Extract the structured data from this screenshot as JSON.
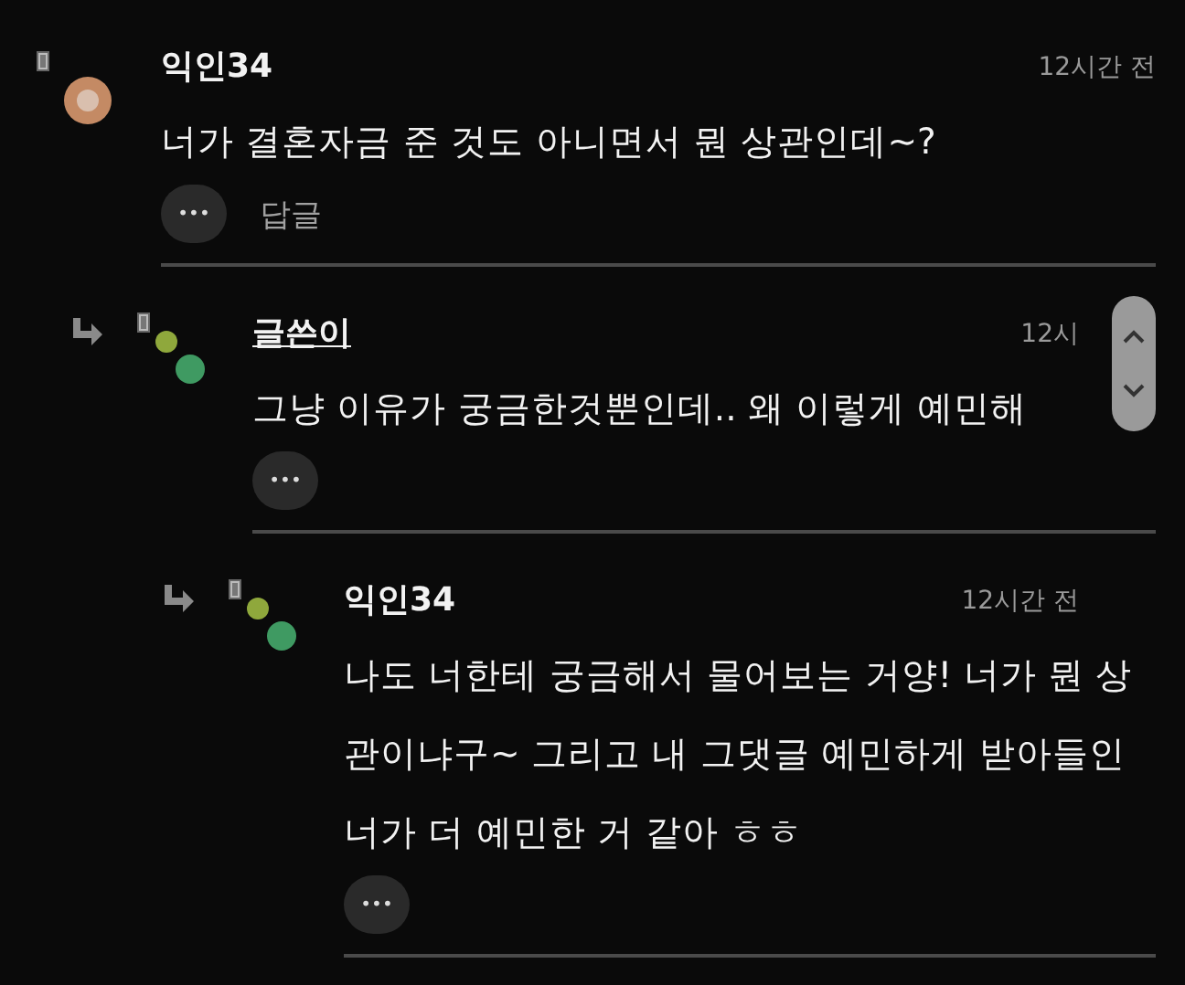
{
  "comments": [
    {
      "author": "익인34",
      "is_writer": false,
      "kind": "circle",
      "time": "12시간 전",
      "body": "너가 결혼자금 준 것도 아니면서 뭔 상관인데~?",
      "more": "•••",
      "reply": "답글",
      "children": [
        {
          "author": "글쓴이",
          "is_writer": true,
          "kind": "dots",
          "time": "12시",
          "body": "그냥 이유가 궁금한것뿐인데.. 왜 이렇게 예민해",
          "more": "•••",
          "children": [
            {
              "author": "익인34",
              "is_writer": false,
              "kind": "dots",
              "time": "12시간 전",
              "body": "나도 너한테 궁금해서 물어보는 거양! 너가 뭔 상관이냐구~ 그리고 내 그댓글 예민하게 받아들인 너가 더 예민한 거 같아 ㅎㅎ",
              "more": "•••"
            }
          ]
        }
      ]
    }
  ]
}
